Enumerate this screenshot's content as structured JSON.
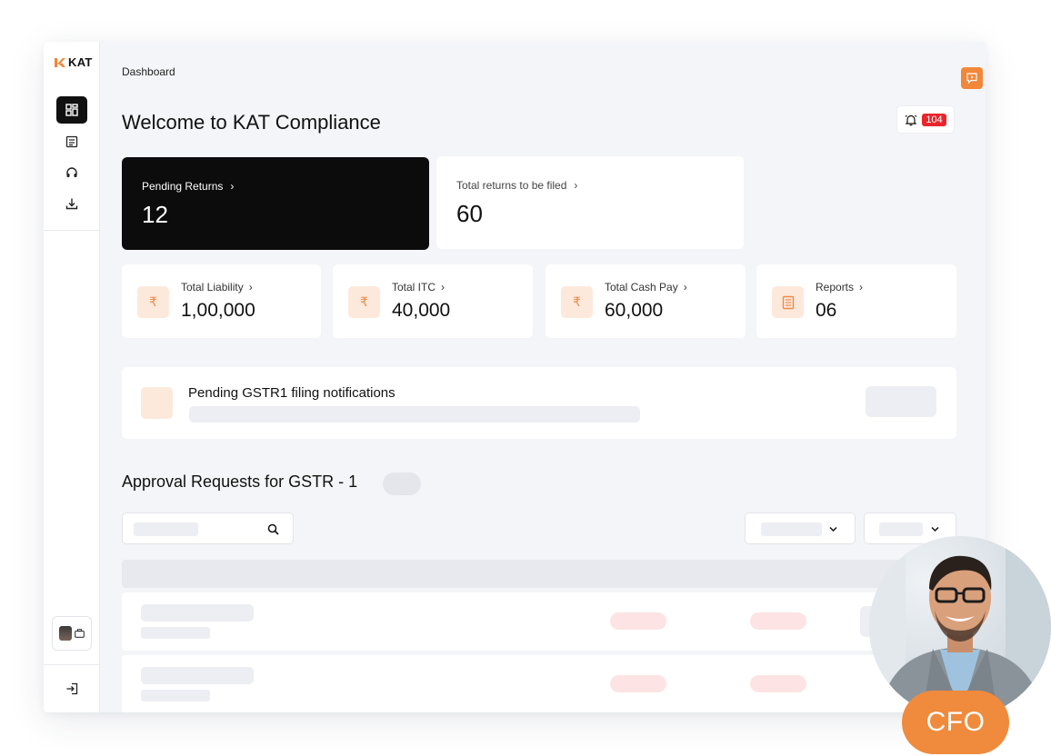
{
  "brand": {
    "name": "KAT",
    "accent": "#f2873a"
  },
  "sidebar": {
    "items": [
      {
        "icon": "dashboard-icon",
        "active": true
      },
      {
        "icon": "returns-icon",
        "active": false
      },
      {
        "icon": "headset-icon",
        "active": false
      },
      {
        "icon": "download-icon",
        "active": false
      }
    ],
    "logout_icon": "logout-icon"
  },
  "header": {
    "breadcrumb": "Dashboard",
    "title": "Welcome to KAT Compliance",
    "notifications_count": "104"
  },
  "summary_cards": [
    {
      "label": "Pending Returns",
      "value": "12"
    },
    {
      "label": "Total returns to be filed",
      "value": "60"
    }
  ],
  "stats": [
    {
      "label": "Total Liability",
      "value": "1,00,000",
      "icon": "rupee-icon"
    },
    {
      "label": "Total ITC",
      "value": "40,000",
      "icon": "rupee-icon"
    },
    {
      "label": "Total Cash Pay",
      "value": "60,000",
      "icon": "rupee-icon"
    },
    {
      "label": "Reports",
      "value": "06",
      "icon": "report-icon"
    }
  ],
  "notice": {
    "title": "Pending GSTR1 filing notifications"
  },
  "approvals": {
    "title": "Approval Requests for GSTR - 1"
  },
  "overlay": {
    "badge": "CFO"
  }
}
